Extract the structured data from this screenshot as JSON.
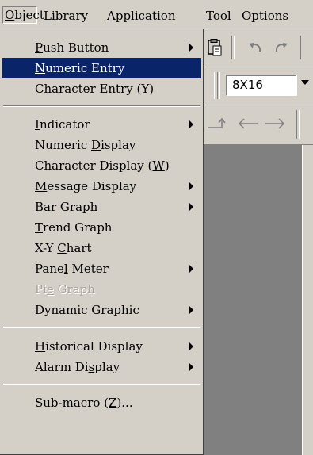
{
  "menubar": {
    "object": {
      "mn": "O",
      "rest": "bject"
    },
    "library": {
      "mn": "L",
      "rest": "ibrary"
    },
    "application": {
      "mn": "A",
      "rest": "pplication"
    },
    "tool": {
      "mn": "T",
      "rest": "ool"
    },
    "options": {
      "text": "Options"
    }
  },
  "toolbar": {
    "font_size": "8X16",
    "icons": [
      "paste-icon",
      "undo-icon",
      "redo-icon",
      "align-icon",
      "arrow-left-icon",
      "arrow-right-icon"
    ]
  },
  "menu": {
    "push_button": {
      "pre": "",
      "mn": "P",
      "post": "ush Button"
    },
    "numeric_entry": {
      "pre": "",
      "mn": "N",
      "post": "umeric Entry"
    },
    "character_entry": {
      "pre": "Character Entry (",
      "mn": "Y",
      "post": ")"
    },
    "indicator": {
      "pre": "",
      "mn": "I",
      "post": "ndicator"
    },
    "numeric_display": {
      "pre": "Numeric ",
      "mn": "D",
      "post": "isplay"
    },
    "character_display": {
      "pre": "Character Display (",
      "mn": "W",
      "post": ")"
    },
    "message_display": {
      "pre": "",
      "mn": "M",
      "post": "essage Display"
    },
    "bar_graph": {
      "pre": "",
      "mn": "B",
      "post": "ar Graph"
    },
    "trend_graph": {
      "pre": "",
      "mn": "T",
      "post": "rend Graph"
    },
    "xy_chart": {
      "pre": "X-Y ",
      "mn": "C",
      "post": "hart"
    },
    "panel_meter": {
      "pre": "Pane",
      "mn": "l",
      "post": " Meter"
    },
    "pie_graph": {
      "pre": "Pi",
      "mn": "e",
      "post": " Graph"
    },
    "dynamic_graphic": {
      "pre": "D",
      "mn": "y",
      "post": "namic Graphic"
    },
    "historical_display": {
      "pre": "",
      "mn": "H",
      "post": "istorical Display"
    },
    "alarm_display": {
      "pre": "Alarm Di",
      "mn": "s",
      "post": "play"
    },
    "sub_macro": {
      "pre": "Sub-macro (",
      "mn": "Z",
      "post": ")..."
    }
  },
  "colors": {
    "menu_bg": "#d4d0c8",
    "highlight": "#0a246a",
    "workspace": "#808080",
    "disabled_text": "#a8a49c"
  }
}
